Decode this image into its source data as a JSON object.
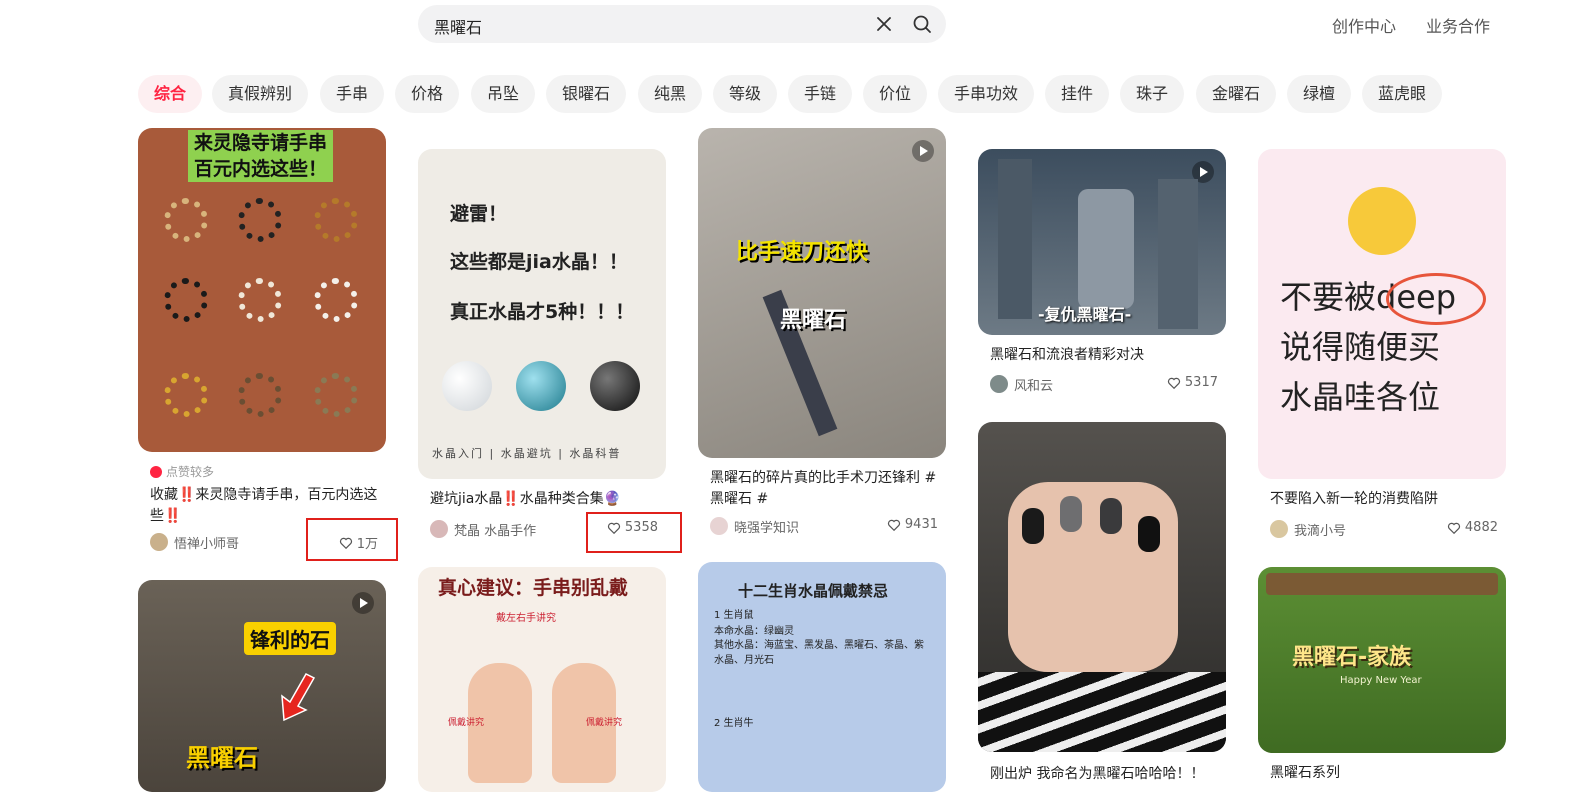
{
  "search": {
    "query": "黑曜石"
  },
  "top_links": [
    "创作中心",
    "业务合作"
  ],
  "chips": [
    "综合",
    "真假辨别",
    "手串",
    "价格",
    "吊坠",
    "银曜石",
    "纯黑",
    "等级",
    "手链",
    "价位",
    "手串功效",
    "挂件",
    "珠子",
    "金曜石",
    "绿檀",
    "蓝虎眼"
  ],
  "cards": {
    "c1": {
      "overlay_title": "来灵隐寺请手串\n百元内选这些！",
      "hot_tag": "点赞较多",
      "title": "收藏‼️来灵隐寺请手串，百元内选这些‼️",
      "author": "悟禅小师哥",
      "likes": "1万"
    },
    "c2": {
      "overlay_lines": [
        "避雷！",
        "这些都是jia水晶！！",
        "真正水晶才5种！！！"
      ],
      "footer": "水晶入门 | 水晶避坑 | 水晶科普",
      "title": "避坑jia水晶‼️水晶种类合集🔮",
      "author": "梵晶 水晶手作",
      "likes": "5358"
    },
    "c3": {
      "overlay_top": "比手速刀还快",
      "overlay_mid": "黑曜石",
      "title": "黑曜石的碎片真的比手术刀还锋利 #黑曜石 #",
      "author": "晓强学知识",
      "likes": "9431"
    },
    "c4": {
      "overlay": "-复仇黑曜石-",
      "title": "黑曜石和流浪者精彩对决",
      "author": "风和云",
      "likes": "5317"
    },
    "c5": {
      "overlay_text": [
        "不要被deep",
        "说得随便买",
        "水晶哇各位"
      ],
      "title": "不要陷入新一轮的消费陷阱",
      "author": "我滴小号",
      "likes": "4882"
    },
    "c6": {
      "overlay_top": "锋利的石",
      "overlay_bottom": "黑曜石"
    },
    "c7": {
      "overlay_title": "真心建议：手串别乱戴",
      "label1": "戴左右手讲究",
      "label2": "佩戴讲究",
      "label3": "佩戴讲究"
    },
    "c8": {
      "overlay_title": "十二生肖水晶佩戴禁忌",
      "line1": "1 生肖鼠",
      "line2": "本命水晶：绿幽灵",
      "line3": "其他水晶：海蓝宝、黑发晶、黑曜石、茶晶、紫水晶、月光石",
      "line4": "2 生肖牛"
    },
    "c9": {
      "title": "刚出炉 我命名为黑曜石哈哈哈！！"
    },
    "c10": {
      "overlay": "黑曜石-家族",
      "sub": "Happy New Year",
      "title": "黑曜石系列"
    }
  },
  "colors": {
    "accent": "#ff2442",
    "highlight_box": "#e0201b"
  },
  "icons": [
    "close-icon",
    "search-icon",
    "heart-icon",
    "play-icon",
    "flame-icon"
  ]
}
